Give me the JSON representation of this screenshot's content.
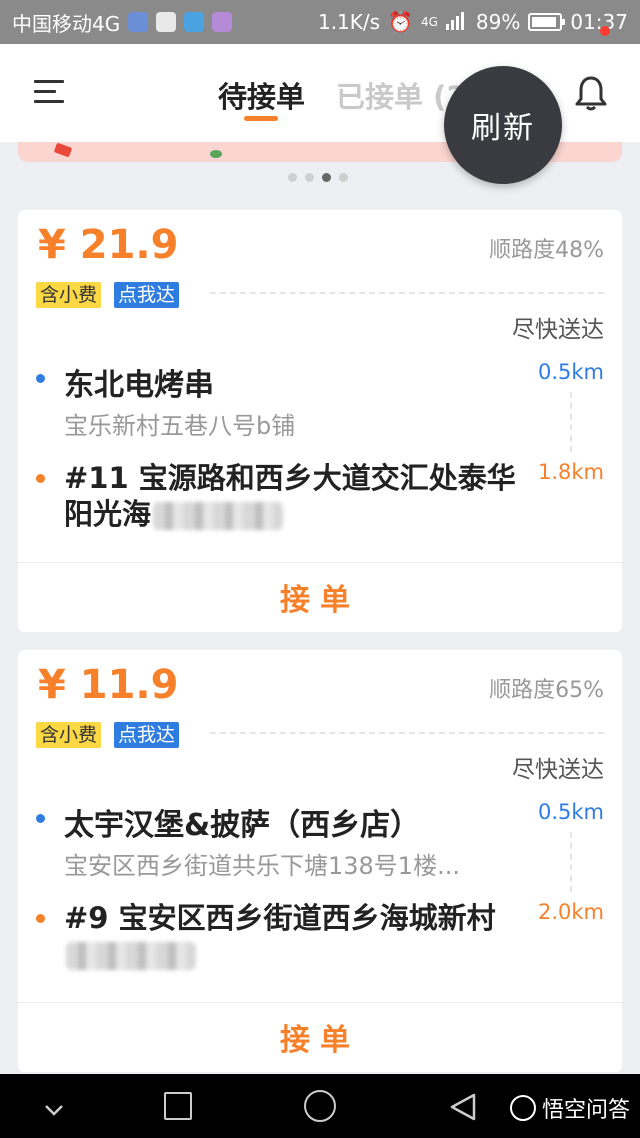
{
  "status_bar": {
    "carrier": "中国移动4G",
    "net_speed": "1.1K/s",
    "signal": "4G",
    "battery": "89%",
    "time": "01:37"
  },
  "header": {
    "tab_pending": "待接单",
    "tab_accepted": "已接单 (2)",
    "refresh_label": "刷新"
  },
  "orders": [
    {
      "price": "¥ 21.9",
      "match": "顺路度48%",
      "tag_tip": "含小费",
      "tag_call": "点我达",
      "delivery": "尽快送达",
      "shop_name": "东北电烤串",
      "shop_address": "宝乐新村五巷八号b铺",
      "pickup_distance": "0.5km",
      "destination": "#11 宝源路和西乡大道交汇处泰华阳光海",
      "dest_distance": "1.8km",
      "accept": "接单"
    },
    {
      "price": "¥ 11.9",
      "match": "顺路度65%",
      "tag_tip": "含小费",
      "tag_call": "点我达",
      "delivery": "尽快送达",
      "shop_name": "太宇汉堡&披萨（西乡店）",
      "shop_address": "宝安区西乡街道共乐下塘138号1楼...",
      "pickup_distance": "0.5km",
      "destination": "#9 宝安区西乡街道西乡海城新村",
      "dest_distance": "2.0km",
      "accept": "接单"
    }
  ],
  "watermark": "悟空问答",
  "colors": {
    "accent": "#f7812b",
    "blue": "#2f7de0",
    "tip_tag": "#fcd845"
  }
}
